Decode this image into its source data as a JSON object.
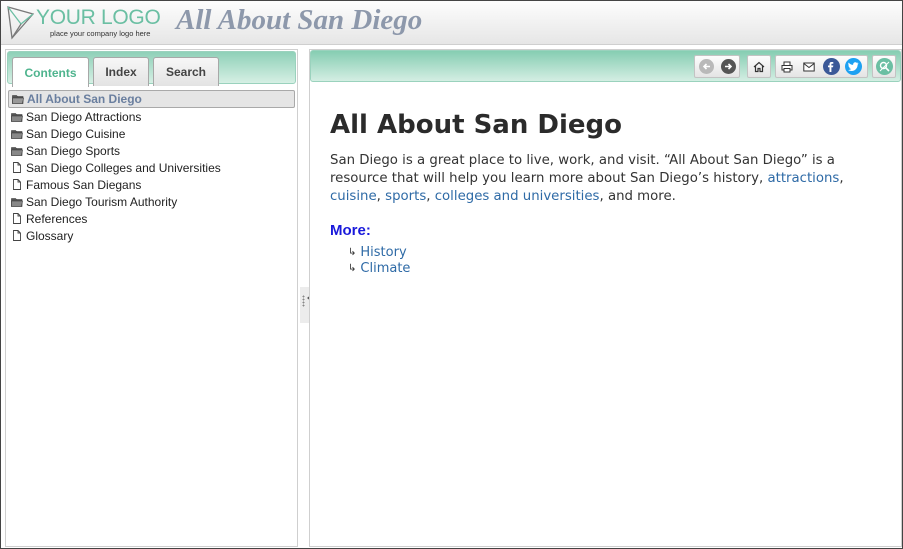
{
  "header": {
    "logo_text": "YOUR LOGO",
    "logo_tagline": "place your company logo here",
    "site_title": "All About San Diego"
  },
  "tabs": [
    {
      "label": "Contents",
      "active": true
    },
    {
      "label": "Index",
      "active": false
    },
    {
      "label": "Search",
      "active": false
    }
  ],
  "tree": [
    {
      "label": "All About San Diego",
      "icon": "folder-open-icon",
      "selected": true
    },
    {
      "label": "San Diego Attractions",
      "icon": "folder-icon"
    },
    {
      "label": "San Diego Cuisine",
      "icon": "folder-icon"
    },
    {
      "label": "San Diego Sports",
      "icon": "folder-icon"
    },
    {
      "label": "San Diego Colleges and Universities",
      "icon": "page-icon"
    },
    {
      "label": "Famous San Diegans",
      "icon": "page-icon"
    },
    {
      "label": "San Diego Tourism Authority",
      "icon": "folder-icon"
    },
    {
      "label": "References",
      "icon": "page-icon"
    },
    {
      "label": "Glossary",
      "icon": "page-icon"
    }
  ],
  "toolbar": {
    "icons": [
      "back-icon",
      "forward-icon",
      "home-icon",
      "print-icon",
      "email-icon",
      "facebook-icon",
      "twitter-icon",
      "search-highlight-icon"
    ]
  },
  "topic": {
    "title": "All About San Diego",
    "para_1": "San Diego is a great place to live, work, and visit. “All About San Diego” is a resource that will help you learn more about San Diego’s history, ",
    "link_attractions": "attractions",
    "sep_1": ", ",
    "link_cuisine": "cuisine",
    "sep_2": ", ",
    "link_sports": "sports",
    "sep_3": ", ",
    "link_colleges": "colleges and universities",
    "para_end": ", and more.",
    "more_heading": "More:",
    "more_links": [
      "History",
      "Climate"
    ]
  },
  "colors": {
    "accent": "#6bbfa3",
    "link": "#2e6aa6",
    "more_heading": "#1a1adb",
    "title_gray": "#8d98ab",
    "facebook": "#3b5998",
    "twitter": "#1da1f2"
  }
}
